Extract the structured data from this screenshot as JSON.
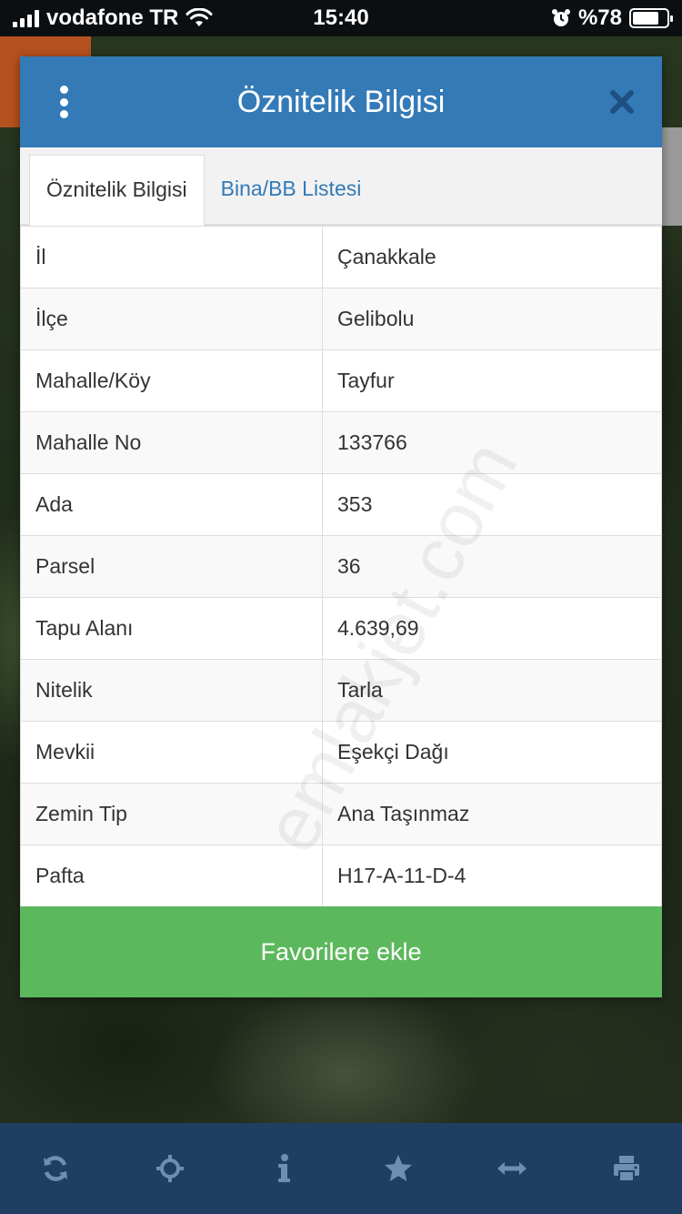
{
  "status_bar": {
    "carrier": "vodafone TR",
    "time": "15:40",
    "battery": "%78",
    "battery_level": 0.78
  },
  "modal": {
    "title": "Öznitelik Bilgisi",
    "tabs": [
      {
        "label": "Öznitelik Bilgisi",
        "active": true
      },
      {
        "label": "Bina/BB Listesi",
        "active": false
      }
    ],
    "rows": [
      {
        "key": "İl",
        "value": "Çanakkale"
      },
      {
        "key": "İlçe",
        "value": "Gelibolu"
      },
      {
        "key": "Mahalle/Köy",
        "value": "Tayfur"
      },
      {
        "key": "Mahalle No",
        "value": "133766"
      },
      {
        "key": "Ada",
        "value": "353"
      },
      {
        "key": "Parsel",
        "value": "36"
      },
      {
        "key": "Tapu Alanı",
        "value": "4.639,69"
      },
      {
        "key": "Nitelik",
        "value": "Tarla"
      },
      {
        "key": "Mevkii",
        "value": "Eşekçi Dağı"
      },
      {
        "key": "Zemin Tip",
        "value": "Ana Taşınmaz"
      },
      {
        "key": "Pafta",
        "value": "H17-A-11-D-4"
      }
    ],
    "favorite_button": "Favorilere ekle"
  },
  "watermark": "emlakjet.com",
  "toolbar": {
    "icons": [
      "refresh-icon",
      "crosshair-icon",
      "info-icon",
      "star-icon",
      "measure-icon",
      "print-icon"
    ]
  },
  "colors": {
    "header": "#337ab7",
    "favorite_button": "#5cb85c",
    "toolbar": "#1f3f62",
    "toolbar_icon": "#6f8fb0"
  }
}
